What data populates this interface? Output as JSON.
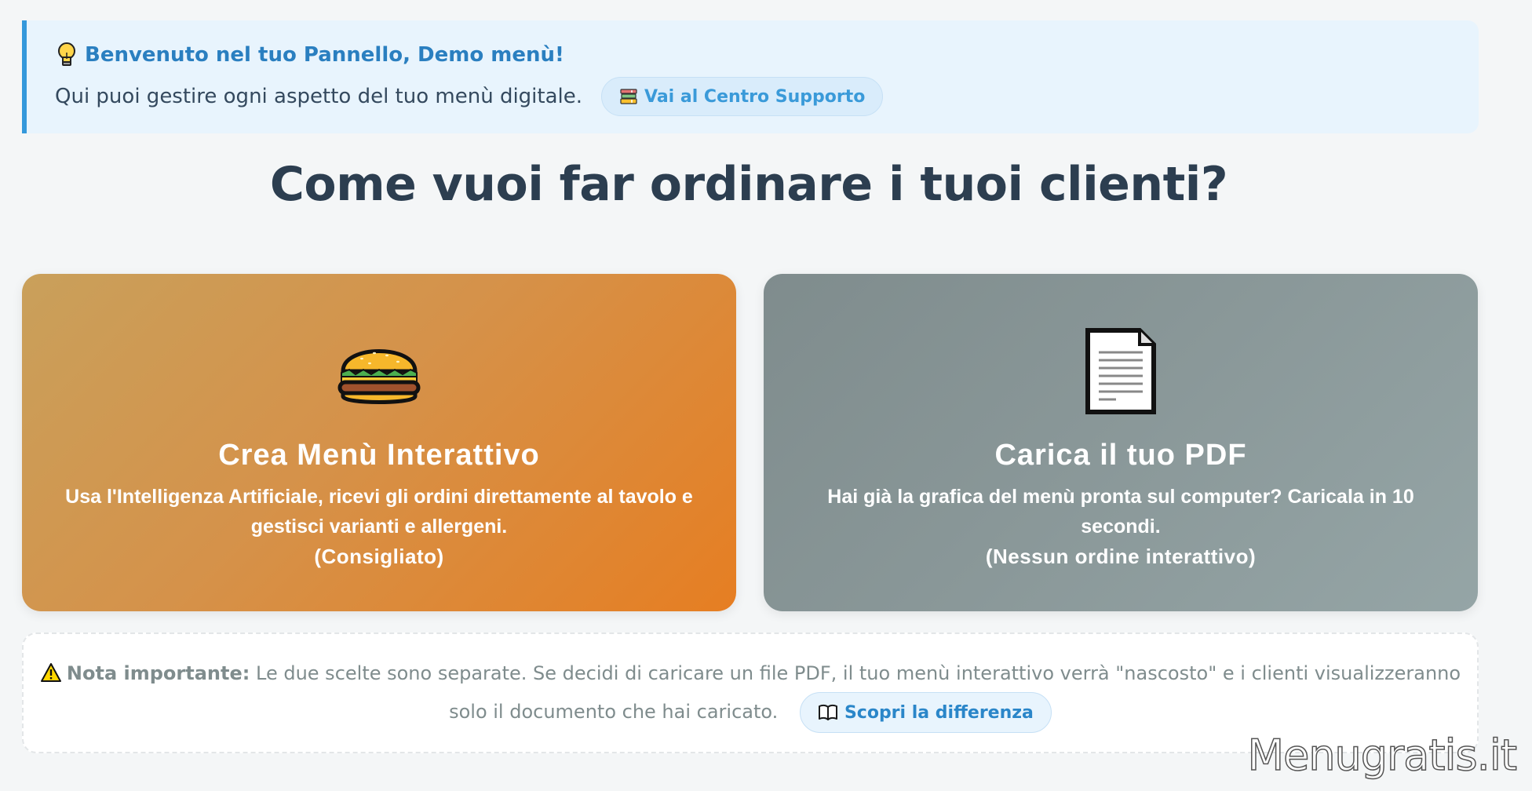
{
  "welcome": {
    "title": "Benvenuto nel tuo Pannello, Demo menù!",
    "text": "Qui puoi gestire ogni aspetto del tuo menù digitale.",
    "support_link": "Vai al Centro Supporto",
    "accent_color": "#3498db",
    "icons": {
      "title": "lightbulb-icon",
      "support": "books-icon"
    }
  },
  "page_title": "Come vuoi far ordinare i tuoi clienti?",
  "cards": [
    {
      "icon": "hamburger-icon",
      "title": "Crea Menù Interattivo",
      "description": "Usa l'Intelligenza Artificiale, ricevi gli ordini direttamente al tavolo e gestisci varianti e allergeni.",
      "note": "(Consigliato)",
      "color": "#e67e22"
    },
    {
      "icon": "document-icon",
      "title": "Carica il tuo PDF",
      "description": "Hai già la grafica del menù pronta sul computer? Caricala in 10 secondi.",
      "note": "(Nessun ordine interattivo)",
      "color": "#7f8c8d"
    }
  ],
  "notice": {
    "icon": "warning-icon",
    "label": "Nota importante:",
    "text": "Le due scelte sono separate. Se decidi di caricare un file PDF, il tuo menù interattivo verrà \"nascosto\" e i clienti visualizzeranno solo il documento che hai caricato.",
    "link": "Scopri la differenza",
    "link_icon": "open-book-icon"
  },
  "watermark": "Menugratis.it"
}
